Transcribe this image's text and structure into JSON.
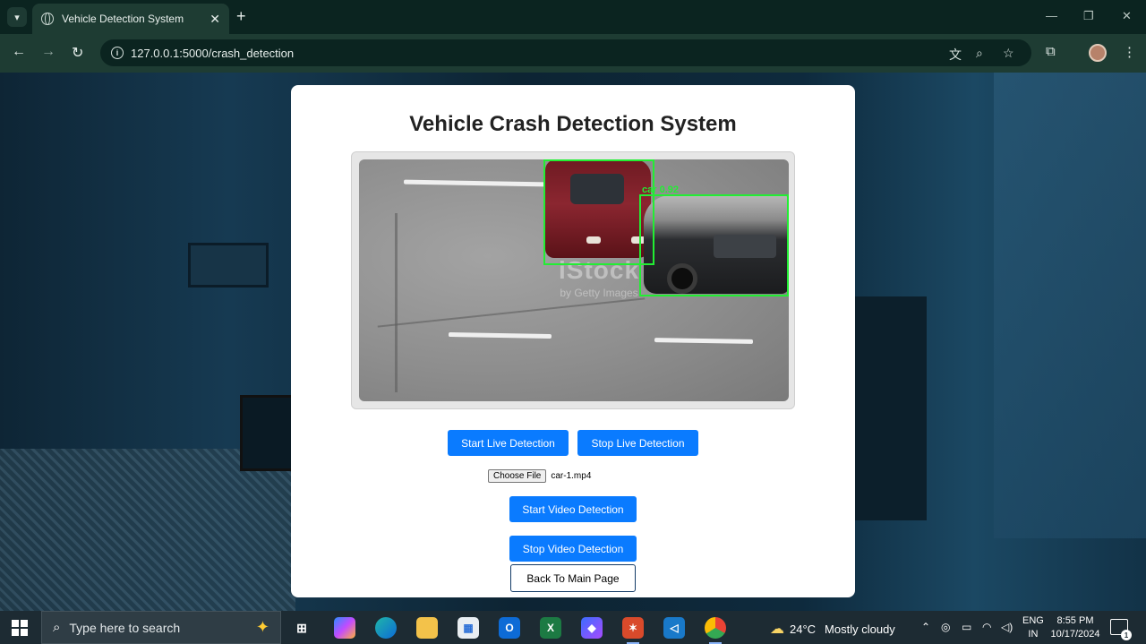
{
  "browser": {
    "tab_title": "Vehicle Detection System",
    "tab_close": "✕",
    "new_tab": "+",
    "url": "127.0.0.1:5000/crash_detection"
  },
  "page": {
    "title": "Vehicle Crash Detection System",
    "video": {
      "watermark": "iStock",
      "watermark_sub": "by Getty Images",
      "detections": [
        {
          "label": "car",
          "confidence": "0.92",
          "label_text": "car 0.92"
        }
      ]
    },
    "buttons": {
      "start_live": "Start Live Detection",
      "stop_live": "Stop Live Detection",
      "choose_file": "Choose File",
      "start_video": "Start Video Detection",
      "stop_video": "Stop Video Detection",
      "back_main": "Back To Main Page"
    },
    "file_name": "car-1.mp4",
    "colors": {
      "primary_button": "#0a7bff",
      "detection_box": "#22ee33"
    }
  },
  "taskbar": {
    "search_placeholder": "Type here to search",
    "weather_temp": "24°C",
    "weather_text": "Mostly cloudy",
    "lang_top": "ENG",
    "lang_bottom": "IN",
    "time": "8:55 PM",
    "date": "10/17/2024",
    "notification_count": "1",
    "apps": [
      "task-view",
      "copilot",
      "edge",
      "file-explorer",
      "microsoft-store",
      "outlook",
      "excel",
      "designer",
      "git-app",
      "vscode",
      "chrome"
    ]
  }
}
